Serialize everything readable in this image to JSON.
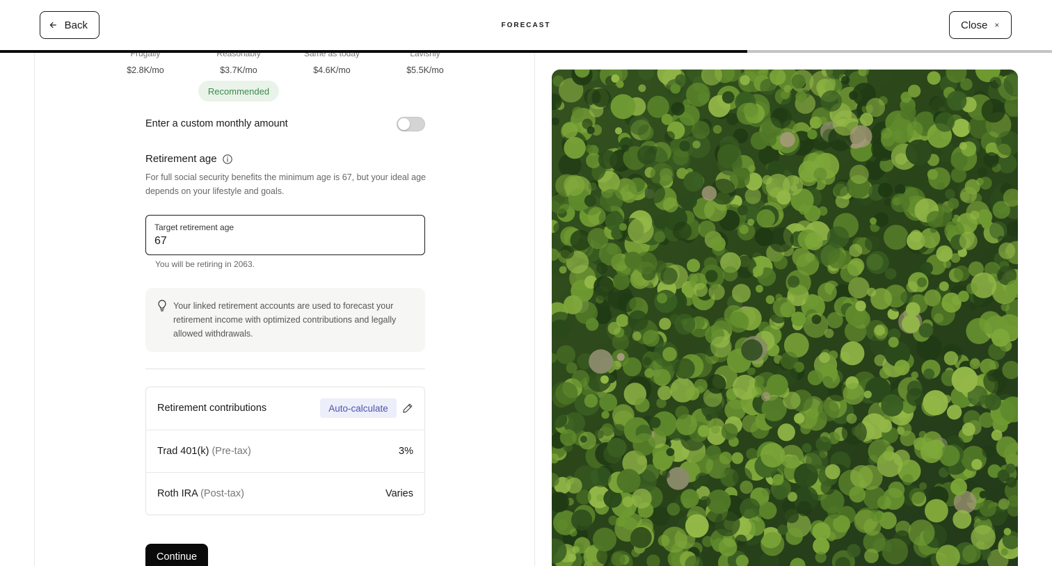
{
  "header": {
    "back_label": "Back",
    "title": "FORECAST",
    "close_label": "Close",
    "progress_fraction": 0.71
  },
  "spending": {
    "options": [
      {
        "name": "Frugally",
        "amount": "$2.8K/mo"
      },
      {
        "name": "Reasonably",
        "amount": "$3.7K/mo"
      },
      {
        "name": "Same as today",
        "amount": "$4.6K/mo"
      },
      {
        "name": "Lavishly",
        "amount": "$5.5K/mo"
      }
    ],
    "recommended_label": "Recommended"
  },
  "custom_amount": {
    "label": "Enter a custom monthly amount",
    "enabled": false
  },
  "retirement": {
    "heading": "Retirement age",
    "description": "For full social security benefits the minimum age is 67, but your ideal age depends on your lifestyle and goals.",
    "field_label": "Target retirement age",
    "field_value": "67",
    "hint": "You will be retiring in 2063."
  },
  "tip": {
    "text": "Your linked retirement accounts are used to forecast your retirement income with optimized contributions and legally allowed withdrawals."
  },
  "contributions": {
    "title": "Retirement contributions",
    "badge": "Auto-calculate",
    "rows": [
      {
        "name": "Trad 401(k)",
        "sub": "(Pre-tax)",
        "value": "3%"
      },
      {
        "name": "Roth IRA",
        "sub": "(Post-tax)",
        "value": "Varies"
      }
    ]
  },
  "continue_label": "Continue",
  "colors": {
    "accent_dark": "#0a0a0a",
    "recommended_bg": "#e9f3ea",
    "recommended_text": "#3c8a4a",
    "auto_bg": "#eceefa",
    "auto_text": "#4c55a8"
  }
}
